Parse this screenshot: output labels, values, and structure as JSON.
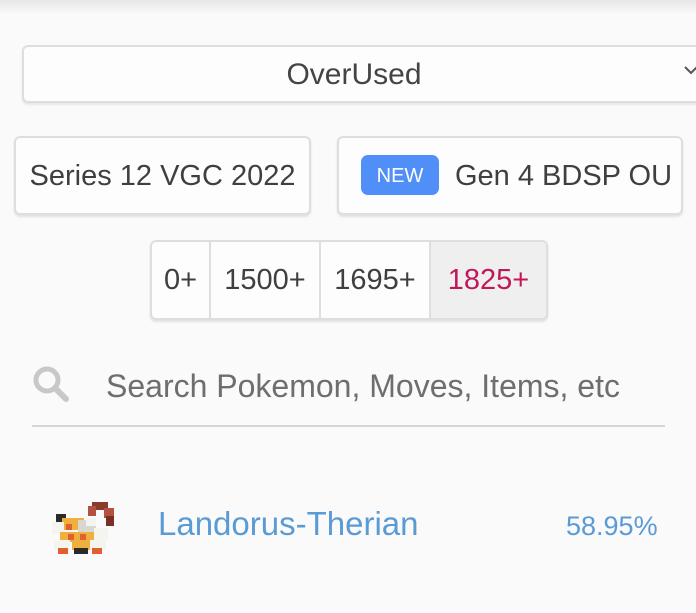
{
  "format_select": {
    "value": "OverUsed",
    "icon": "chevron-down-icon"
  },
  "series_buttons": {
    "vgc_label": "Series 12 VGC 2022",
    "bdsp_badge": "NEW",
    "bdsp_label": "Gen 4 BDSP OU"
  },
  "ratings": {
    "options": [
      "0+",
      "1500+",
      "1695+",
      "1825+"
    ],
    "selected": "1825+",
    "selected_color": "#c2185b"
  },
  "search": {
    "placeholder": "Search Pokemon, Moves, Items, etc",
    "value": "",
    "icon": "search-icon"
  },
  "pokemon_list": [
    {
      "name": "Landorus-Therian",
      "usage": "58.95%",
      "icon": "landorus-therian-sprite-icon"
    }
  ],
  "colors": {
    "accent_link": "#5b9bd5",
    "badge_blue": "#4f8ff7",
    "active_rating": "#c2185b"
  }
}
